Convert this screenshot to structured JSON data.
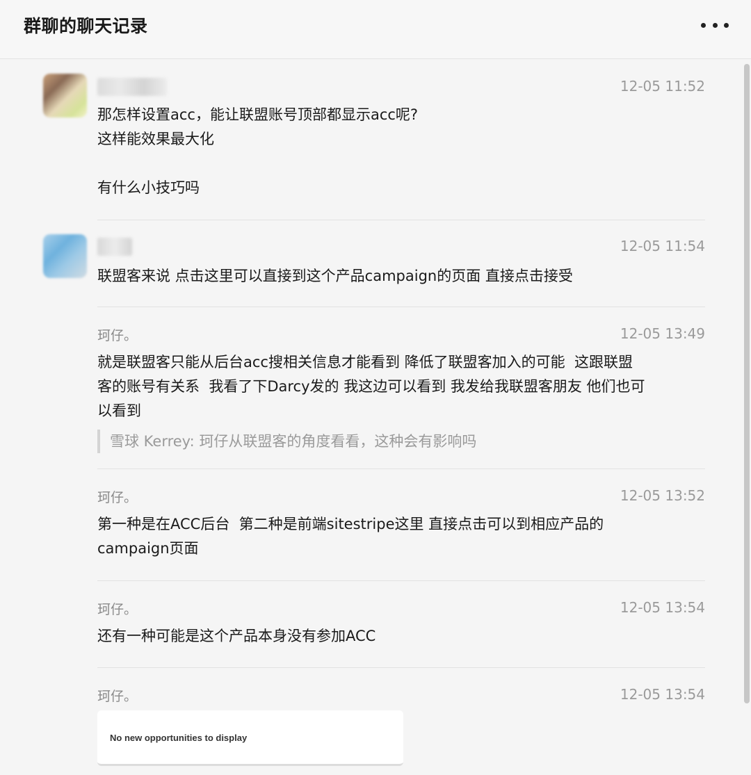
{
  "header": {
    "title": "群聊的聊天记录"
  },
  "messages": [
    {
      "sender": "",
      "time": "12-05 11:52",
      "text": "那怎样设置acc，能让联盟账号顶部都显示acc呢?\n这样能效果最大化\n\n有什么小技巧吗"
    },
    {
      "sender": "",
      "time": "12-05 11:54",
      "text": "联盟客来说 点击这里可以直接到这个产品campaign的页面 直接点击接受"
    },
    {
      "sender": "珂仔。",
      "time": "12-05 13:49",
      "text": "就是联盟客只能从后台acc搜相关信息才能看到 降低了联盟客加入的可能  这跟联盟\n客的账号有关系  我看了下Darcy发的 我这边可以看到 我发给我联盟客朋友 他们也可\n以看到",
      "quote": "雪球 Kerrey: 珂仔从联盟客的角度看看，这种会有影响吗"
    },
    {
      "sender": "珂仔。",
      "time": "12-05 13:52",
      "text": "第一种是在ACC后台  第二种是前端sitestripe这里 直接点击可以到相应产品的\ncampaign页面"
    },
    {
      "sender": "珂仔。",
      "time": "12-05 13:54",
      "text": "还有一种可能是这个产品本身没有参加ACC"
    },
    {
      "sender": "珂仔。",
      "time": "12-05 13:54",
      "card_text": "No new opportunities to display"
    }
  ],
  "icons": {
    "more": "more-dots-icon"
  }
}
